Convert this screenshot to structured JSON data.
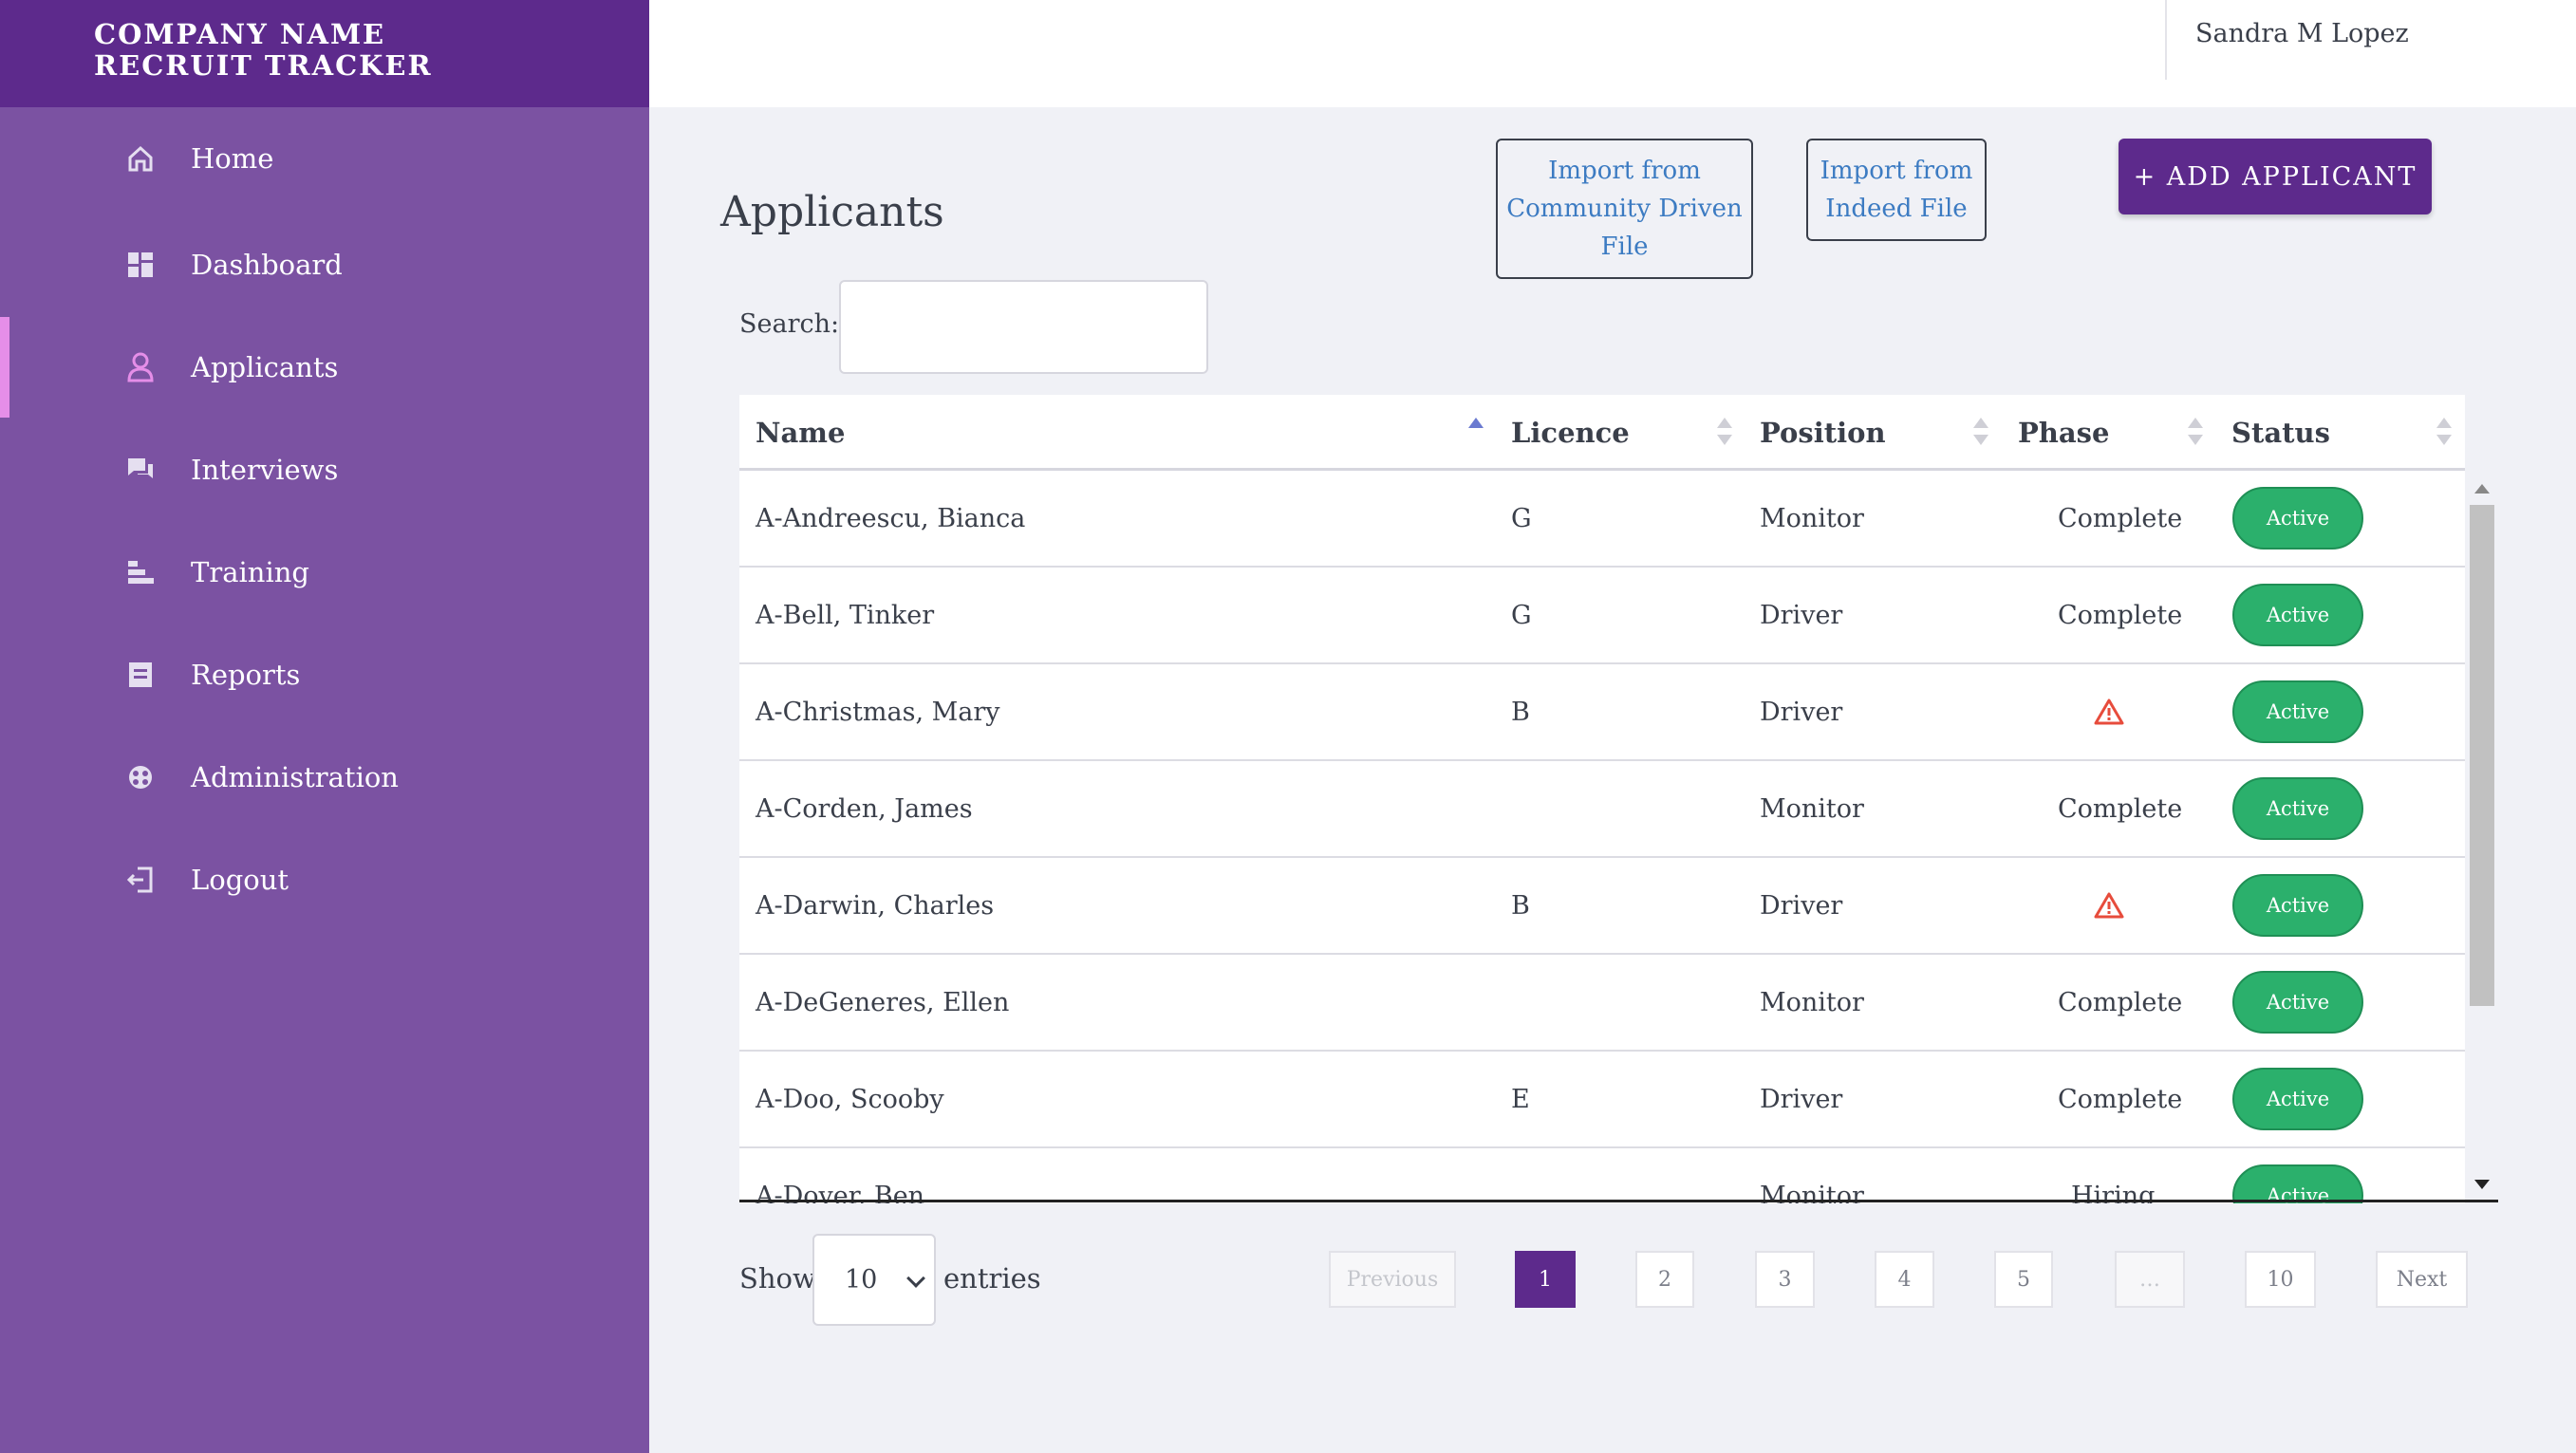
{
  "brand": {
    "line1": "COMPANY NAME",
    "line2": "RECRUIT TRACKER"
  },
  "user": {
    "name": "Sandra M Lopez"
  },
  "sidebar": {
    "items": [
      {
        "label": "Home",
        "icon": "home-icon"
      },
      {
        "label": "Dashboard",
        "icon": "dashboard-icon"
      },
      {
        "label": "Applicants",
        "icon": "user-icon",
        "active": true
      },
      {
        "label": "Interviews",
        "icon": "chat-icon"
      },
      {
        "label": "Training",
        "icon": "bars-icon"
      },
      {
        "label": "Reports",
        "icon": "report-icon"
      },
      {
        "label": "Administration",
        "icon": "globe-icon"
      },
      {
        "label": "Logout",
        "icon": "logout-icon"
      }
    ]
  },
  "main": {
    "title": "Applicants",
    "import_community": "Import from Community Driven File",
    "import_indeed": "Import from Indeed File",
    "add_applicant": "+ ADD APPLICANT",
    "search_label": "Search:",
    "search_value": ""
  },
  "table": {
    "columns": [
      "Name",
      "Licence",
      "Position",
      "Phase",
      "Status"
    ],
    "rows": [
      {
        "name": "A-Andreescu, Bianca",
        "licence": "G",
        "position": "Monitor",
        "phase": "Complete",
        "status": "Active"
      },
      {
        "name": "A-Bell, Tinker",
        "licence": "G",
        "position": "Driver",
        "phase": "Complete",
        "status": "Active"
      },
      {
        "name": "A-Christmas, Mary",
        "licence": "B",
        "position": "Driver",
        "phase": "warning",
        "status": "Active"
      },
      {
        "name": "A-Corden, James",
        "licence": "",
        "position": "Monitor",
        "phase": "Complete",
        "status": "Active"
      },
      {
        "name": "A-Darwin, Charles",
        "licence": "B",
        "position": "Driver",
        "phase": "warning",
        "status": "Active"
      },
      {
        "name": "A-DeGeneres, Ellen",
        "licence": "",
        "position": "Monitor",
        "phase": "Complete",
        "status": "Active"
      },
      {
        "name": "A-Doo, Scooby",
        "licence": "E",
        "position": "Driver",
        "phase": "Complete",
        "status": "Active"
      },
      {
        "name": "A-Dover, Ben",
        "licence": "",
        "position": "Monitor",
        "phase": "Hiring",
        "status": "Active"
      }
    ]
  },
  "footer": {
    "show_label": "Show",
    "entries_value": "10",
    "entries_label": "entries",
    "pagination": [
      "Previous",
      "1",
      "2",
      "3",
      "4",
      "5",
      "…",
      "10",
      "Next"
    ]
  },
  "colors": {
    "brand": "#5d2a8c",
    "sidebar": "#7b52a2",
    "active_badge": "#2bb06c",
    "warning": "#e74c3c",
    "active_indicator": "#e58ee8"
  }
}
